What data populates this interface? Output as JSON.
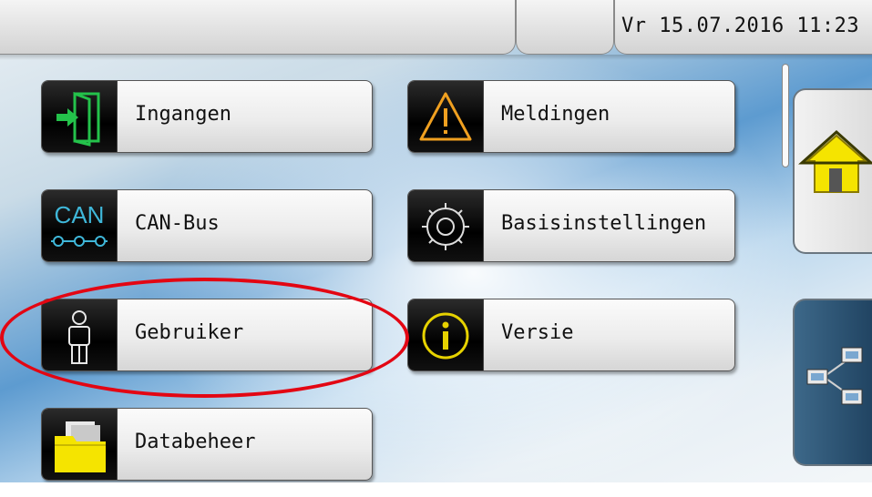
{
  "header": {
    "datetime": "Vr  15.07.2016 11:23"
  },
  "menu": [
    {
      "label": "Ingangen",
      "icon": "inputs-door-icon"
    },
    {
      "label": "Meldingen",
      "icon": "warning-triangle-icon"
    },
    {
      "label": "CAN-Bus",
      "icon": "can-bus-icon",
      "icon_text": "CAN"
    },
    {
      "label": "Basisinstellingen",
      "icon": "gear-icon"
    },
    {
      "label": "Gebruiker",
      "icon": "user-icon"
    },
    {
      "label": "Versie",
      "icon": "info-icon"
    },
    {
      "label": "Databeheer",
      "icon": "folder-icon"
    }
  ],
  "side": {
    "home_icon": "home-icon",
    "network_icon": "network-icon"
  },
  "colors": {
    "highlight_ellipse": "#e30613",
    "warning": "#f0a020",
    "info": "#e6d200",
    "can_text": "#3fb7d9",
    "input_arrow": "#24c24b"
  }
}
